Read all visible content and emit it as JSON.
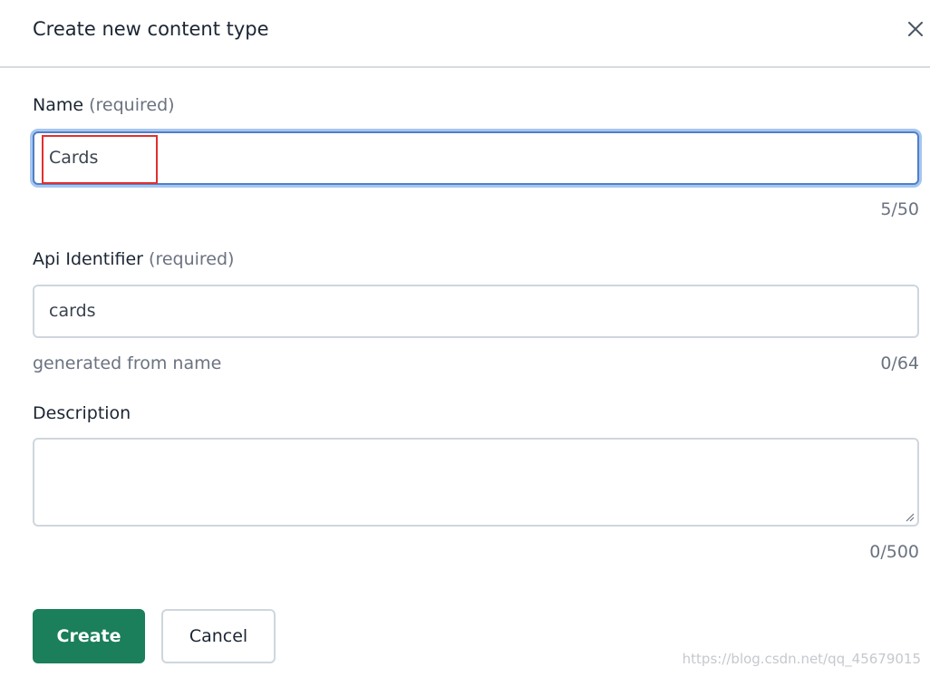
{
  "dialog": {
    "title": "Create new content type",
    "close_icon": "close-icon"
  },
  "name_field": {
    "label": "Name",
    "required": "(required)",
    "value": "Cards",
    "counter": "5/50"
  },
  "api_field": {
    "label": "Api Identifier",
    "required": "(required)",
    "value": "cards",
    "hint": "generated from name",
    "counter": "0/64"
  },
  "description_field": {
    "label": "Description",
    "value": "",
    "counter": "0/500"
  },
  "buttons": {
    "create": "Create",
    "cancel": "Cancel"
  },
  "watermark": "https://blog.csdn.net/qq_45679015",
  "colors": {
    "primary": "#1a7f5a",
    "focus": "#4f7fc9",
    "highlight": "#e0302e"
  }
}
